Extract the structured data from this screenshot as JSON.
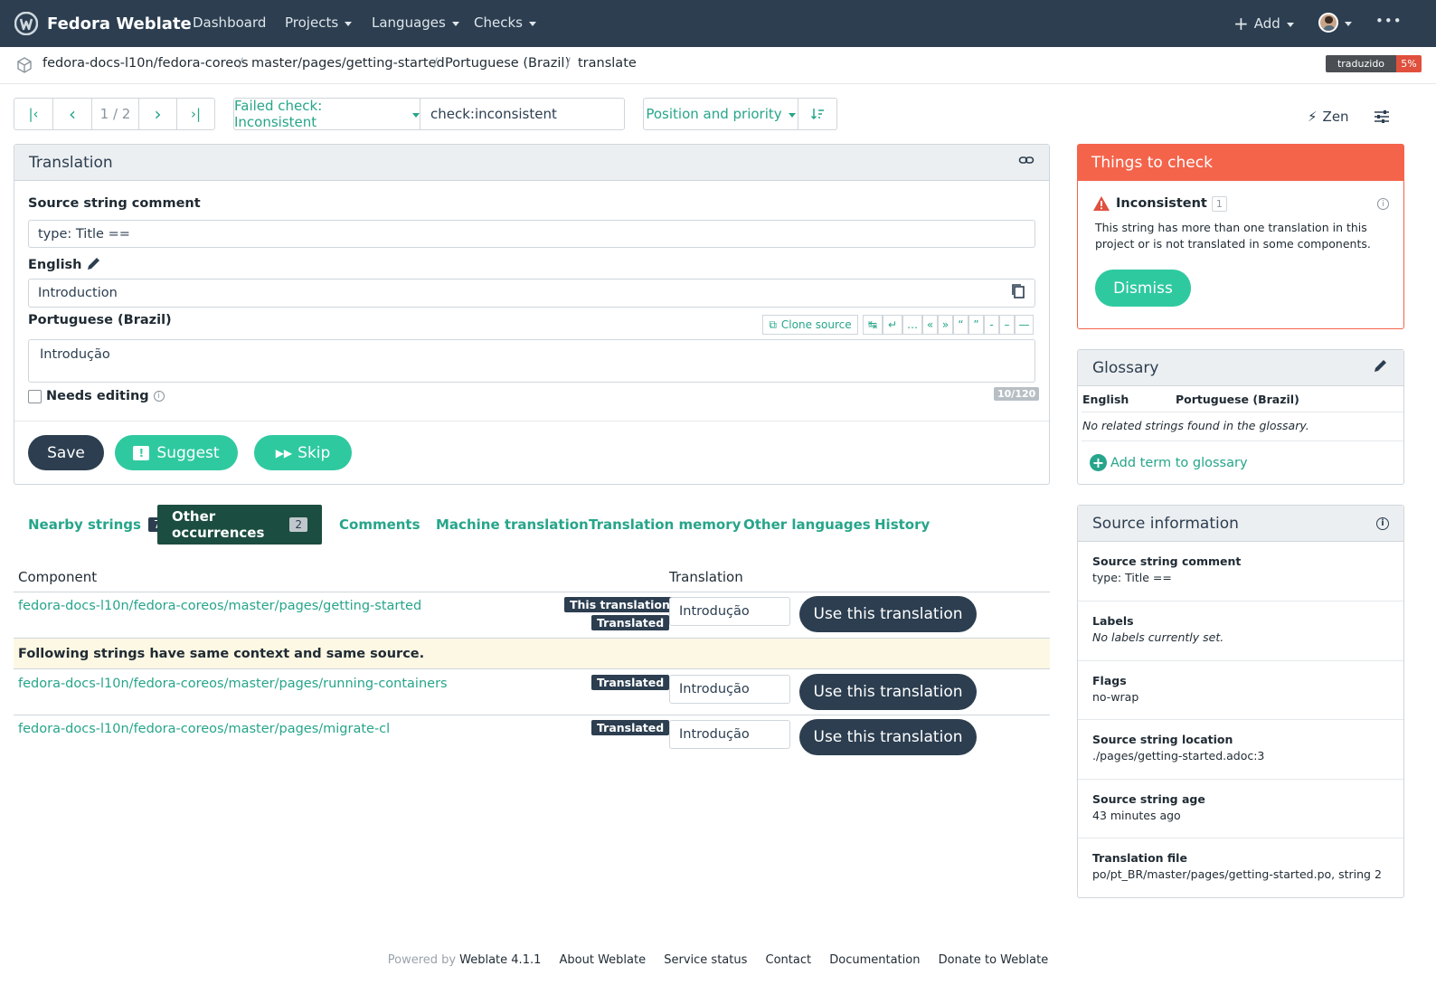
{
  "app": {
    "title": "Fedora Weblate"
  },
  "nav": {
    "items": [
      {
        "label": "Dashboard"
      },
      {
        "label": "Projects"
      },
      {
        "label": "Languages"
      },
      {
        "label": "Checks"
      }
    ],
    "add_label": "Add",
    "more": "•••"
  },
  "breadcrumb": {
    "items": [
      "fedora-docs-l10n/fedora-coreos",
      "master/pages/getting-started",
      "Portuguese (Brazil)",
      "translate"
    ],
    "separator": "/",
    "progress_label": "traduzido",
    "progress_value": "5%"
  },
  "toolbar": {
    "counter": "1 / 2",
    "filter_label": "Failed check: Inconsistent",
    "query": "check:inconsistent",
    "sort_label": "Position and priority",
    "zen_label": "Zen"
  },
  "translation": {
    "title": "Translation",
    "comment_label": "Source string comment",
    "comment_value": "type: Title ==",
    "source_label": "English",
    "source_value": "Introduction",
    "target_label": "Portuguese (Brazil)",
    "clone_label": "Clone source",
    "specials": [
      "↹",
      "↵",
      "…",
      "«",
      "»",
      "“",
      "”",
      "-",
      "–",
      "—"
    ],
    "target_value": "Introdução",
    "needs_editing_label": "Needs editing",
    "char_count": "10/120",
    "save_label": "Save",
    "suggest_label": "Suggest",
    "skip_label": "Skip"
  },
  "tabs": [
    {
      "label": "Nearby strings",
      "count": "7"
    },
    {
      "label": "Other occurrences",
      "count": "2"
    },
    {
      "label": "Comments"
    },
    {
      "label": "Machine translation"
    },
    {
      "label": "Translation memory"
    },
    {
      "label": "Other languages"
    },
    {
      "label": "History"
    }
  ],
  "occurrences": {
    "col_component": "Component",
    "col_translation": "Translation",
    "notice": "Following strings have same context and same source.",
    "use_label": "Use this translation",
    "rows": [
      {
        "component": "fedora-docs-l10n/fedora-coreos/master/pages/getting-started",
        "tags": [
          "This translation",
          "Translated"
        ],
        "value": "Introdução"
      },
      {
        "component": "fedora-docs-l10n/fedora-coreos/master/pages/running-containers",
        "tags": [
          "Translated"
        ],
        "value": "Introdução"
      },
      {
        "component": "fedora-docs-l10n/fedora-coreos/master/pages/migrate-cl",
        "tags": [
          "Translated"
        ],
        "value": "Introdução"
      }
    ]
  },
  "checks": {
    "title": "Things to check",
    "name": "Inconsistent",
    "count": "1",
    "description": "This string has more than one translation in this project or is not translated in some components.",
    "dismiss_label": "Dismiss",
    "accent": "#f4644b"
  },
  "glossary": {
    "title": "Glossary",
    "col_source": "English",
    "col_target": "Portuguese (Brazil)",
    "empty": "No related strings found in the glossary.",
    "add_label": "Add term to glossary"
  },
  "source_info": {
    "title": "Source information",
    "rows": [
      {
        "key": "Source string comment",
        "value": "type: Title ==",
        "italic": false
      },
      {
        "key": "Labels",
        "value": "No labels currently set.",
        "italic": true
      },
      {
        "key": "Flags",
        "value": "no-wrap",
        "italic": false
      },
      {
        "key": "Source string location",
        "value": "./pages/getting-started.adoc:3",
        "italic": false
      },
      {
        "key": "Source string age",
        "value": "43 minutes ago",
        "italic": false
      },
      {
        "key": "Translation file",
        "value": "po/pt_BR/master/pages/getting-started.po, string 2",
        "italic": false
      }
    ]
  },
  "footer": {
    "powered": "Powered by",
    "version": "Weblate 4.1.1",
    "links": [
      "About Weblate",
      "Service status",
      "Contact",
      "Documentation",
      "Donate to Weblate"
    ]
  }
}
